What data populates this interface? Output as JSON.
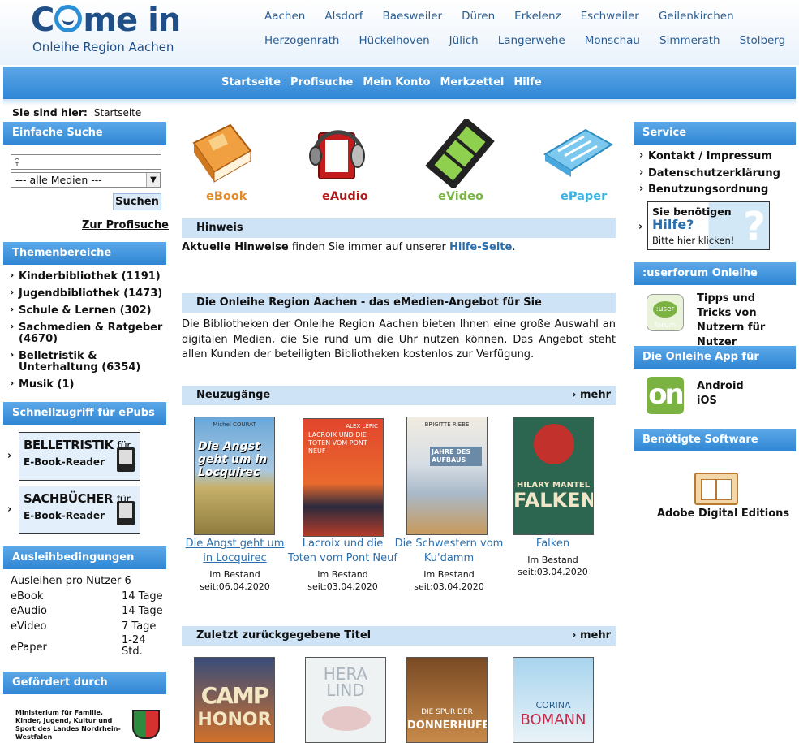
{
  "logo": {
    "brand_pre": "C",
    "brand_post": "me in",
    "subtitle": "Onleihe Region Aachen"
  },
  "towns_row1": [
    "Aachen",
    "Alsdorf",
    "Baesweiler",
    "Düren",
    "Erkelenz",
    "Eschweiler",
    "Geilenkirchen"
  ],
  "towns_row2": [
    "Herzogenrath",
    "Hückelhoven",
    "Jülich",
    "Langerwehe",
    "Monschau",
    "Simmerath",
    "Stolberg"
  ],
  "nav": [
    "Startseite",
    "Profisuche",
    "Mein Konto",
    "Merkzettel",
    "Hilfe"
  ],
  "breadcrumb": {
    "label": "Sie sind hier:",
    "current": "Startseite"
  },
  "left": {
    "simple_search": {
      "title": "Einfache Suche",
      "input_value": "",
      "select_value": "--- alle Medien ---",
      "button": "Suchen",
      "profi_link": "Zur Profisuche"
    },
    "themes": {
      "title": "Themenbereiche",
      "items": [
        "Kinderbibliothek (1191)",
        "Jugendbibliothek (1473)",
        "Schule & Lernen (302)",
        "Sachmedien & Ratgeber (4670)",
        "Belletristik & Unterhaltung (6354)",
        "Musik (1)"
      ]
    },
    "quick": {
      "title": "Schnellzugriff für ePubs",
      "items": [
        {
          "big": "BELLETRISTIK",
          "small": "für",
          "sub": "E-Book-Reader"
        },
        {
          "big": "SACHBÜCHER",
          "small": "für",
          "sub": "E-Book-Reader"
        }
      ]
    },
    "loan": {
      "title": "Ausleihbedingungen",
      "header": "Ausleihen pro Nutzer 6",
      "rows": [
        {
          "k": "eBook",
          "v": "14 Tage"
        },
        {
          "k": "eAudio",
          "v": "14 Tage"
        },
        {
          "k": "eVideo",
          "v": "7 Tage"
        },
        {
          "k": "ePaper",
          "v": "1-24 Std."
        }
      ]
    },
    "sponsor": {
      "title": "Gefördert durch",
      "text": "Ministerium für Familie, Kinder, Jugend, Kultur und Sport des Landes Nordrhein-Westfalen"
    }
  },
  "media": [
    {
      "label": "eBook",
      "color": "#e08a2a"
    },
    {
      "label": "eAudio",
      "color": "#b11a1a"
    },
    {
      "label": "eVideo",
      "color": "#7ab341"
    },
    {
      "label": "ePaper",
      "color": "#3eb1e0"
    }
  ],
  "hint": {
    "title": "Hinweis",
    "bold": "Aktuelle Hinweise",
    "mid": " finden Sie immer auf unserer ",
    "link": "Hilfe-Seite",
    "end": "."
  },
  "intro": {
    "title": "Die Onleihe Region Aachen - das eMedien-Angebot für Sie",
    "text": "Die Bibliotheken der Onleihe Region Aachen bieten Ihnen eine große Auswahl an digitalen Medien, die Sie rund um die Uhr nutzen können. Das Angebot steht allen Kunden der beteiligten Bibliotheken kostenlos zur Verfügung."
  },
  "new_items": {
    "title": "Neuzugänge",
    "more": "› mehr",
    "books": [
      {
        "title": "Die Angst geht um in Locquirec",
        "status": "Im Bestand",
        "date": "seit:06.04.2020",
        "cover_text": "Die Angst geht um in Locquirec",
        "cover_top": "Michel COURAT"
      },
      {
        "title": "Lacroix und die Toten vom Pont Neuf",
        "status": "Im Bestand",
        "date": "seit:03.04.2020",
        "cover_text": "LACROIX UND DIE TOTEN VOM PONT NEUF",
        "cover_top": "ALEX LÉPIC"
      },
      {
        "title": "Die Schwestern vom Ku'damm",
        "status": "Im Bestand",
        "date": "seit:03.04.2020",
        "cover_text": "JAHRE DES AUFBAUS",
        "cover_top": "BRIGITTE RIEBE"
      },
      {
        "title": "Falken",
        "status": "Im Bestand",
        "date": "seit:03.04.2020",
        "cover_text": "FALKEN",
        "cover_top": "HILARY MANTEL"
      }
    ]
  },
  "returned": {
    "title": "Zuletzt zurückgegebene Titel",
    "more": "› mehr",
    "covers": [
      {
        "top": "CAMP",
        "bottom": "HONOR"
      },
      {
        "top": "HERA",
        "bottom": "LIND"
      },
      {
        "top": "DIE SPUR DER",
        "bottom": "DONNERHUFE"
      },
      {
        "top": "CORINA",
        "bottom": "BOMANN"
      }
    ]
  },
  "right": {
    "service": {
      "title": "Service",
      "items": [
        "Kontakt / Impressum",
        "Datenschutzerklärung",
        "Benutzungsordnung"
      ],
      "help_line1": "Sie benötigen",
      "help_line2": "Hilfe?",
      "help_line3": "Bitte hier klicken!"
    },
    "userforum": {
      "title": ":userforum Onleihe",
      "text": "Tipps und Tricks von Nutzern für Nutzer",
      "logo": ":user forum"
    },
    "app": {
      "title": "Die Onleihe App für",
      "android": "Android",
      "ios": "iOS",
      "logo": "on"
    },
    "software": {
      "title": "Benötigte Software",
      "name": "Adobe Digital Editions"
    }
  }
}
